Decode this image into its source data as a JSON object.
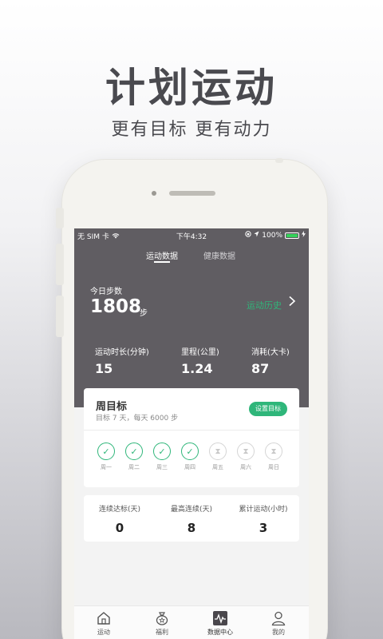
{
  "promo": {
    "title": "计划运动",
    "subtitle": "更有目标 更有动力"
  },
  "status_bar": {
    "carrier": "无 SIM 卡",
    "time": "下午4:32",
    "battery": "100%"
  },
  "tabs": [
    {
      "label": "运动数据",
      "active": true
    },
    {
      "label": "健康数据",
      "active": false
    }
  ],
  "today": {
    "label": "今日步数",
    "steps": "1808",
    "unit": "步",
    "history_link": "运动历史"
  },
  "stats": [
    {
      "label": "运动时长(分钟)",
      "value": "15"
    },
    {
      "label": "里程(公里)",
      "value": "1.24"
    },
    {
      "label": "消耗(大卡)",
      "value": "87"
    }
  ],
  "weekly_goal": {
    "title": "周目标",
    "description": "目标 7 天，每天 6000 步",
    "button": "设置目标",
    "days": [
      {
        "label": "周一",
        "done": true
      },
      {
        "label": "周二",
        "done": true
      },
      {
        "label": "周三",
        "done": true
      },
      {
        "label": "周四",
        "done": true
      },
      {
        "label": "周五",
        "done": false
      },
      {
        "label": "周六",
        "done": false
      },
      {
        "label": "周日",
        "done": false
      }
    ]
  },
  "streaks": [
    {
      "label": "连续达标(天)",
      "value": "0"
    },
    {
      "label": "最高连续(天)",
      "value": "8"
    },
    {
      "label": "累计运动(小时)",
      "value": "3"
    }
  ],
  "bottom_nav": [
    {
      "label": "运动",
      "icon": "home-icon",
      "active": false
    },
    {
      "label": "福利",
      "icon": "gift-bag-icon",
      "active": false
    },
    {
      "label": "数据中心",
      "icon": "pulse-chart-icon",
      "active": true
    },
    {
      "label": "我的",
      "icon": "user-icon",
      "active": false
    }
  ],
  "colors": {
    "accent": "#2fb67a",
    "header": "#605d62",
    "battery": "#35d15a"
  }
}
